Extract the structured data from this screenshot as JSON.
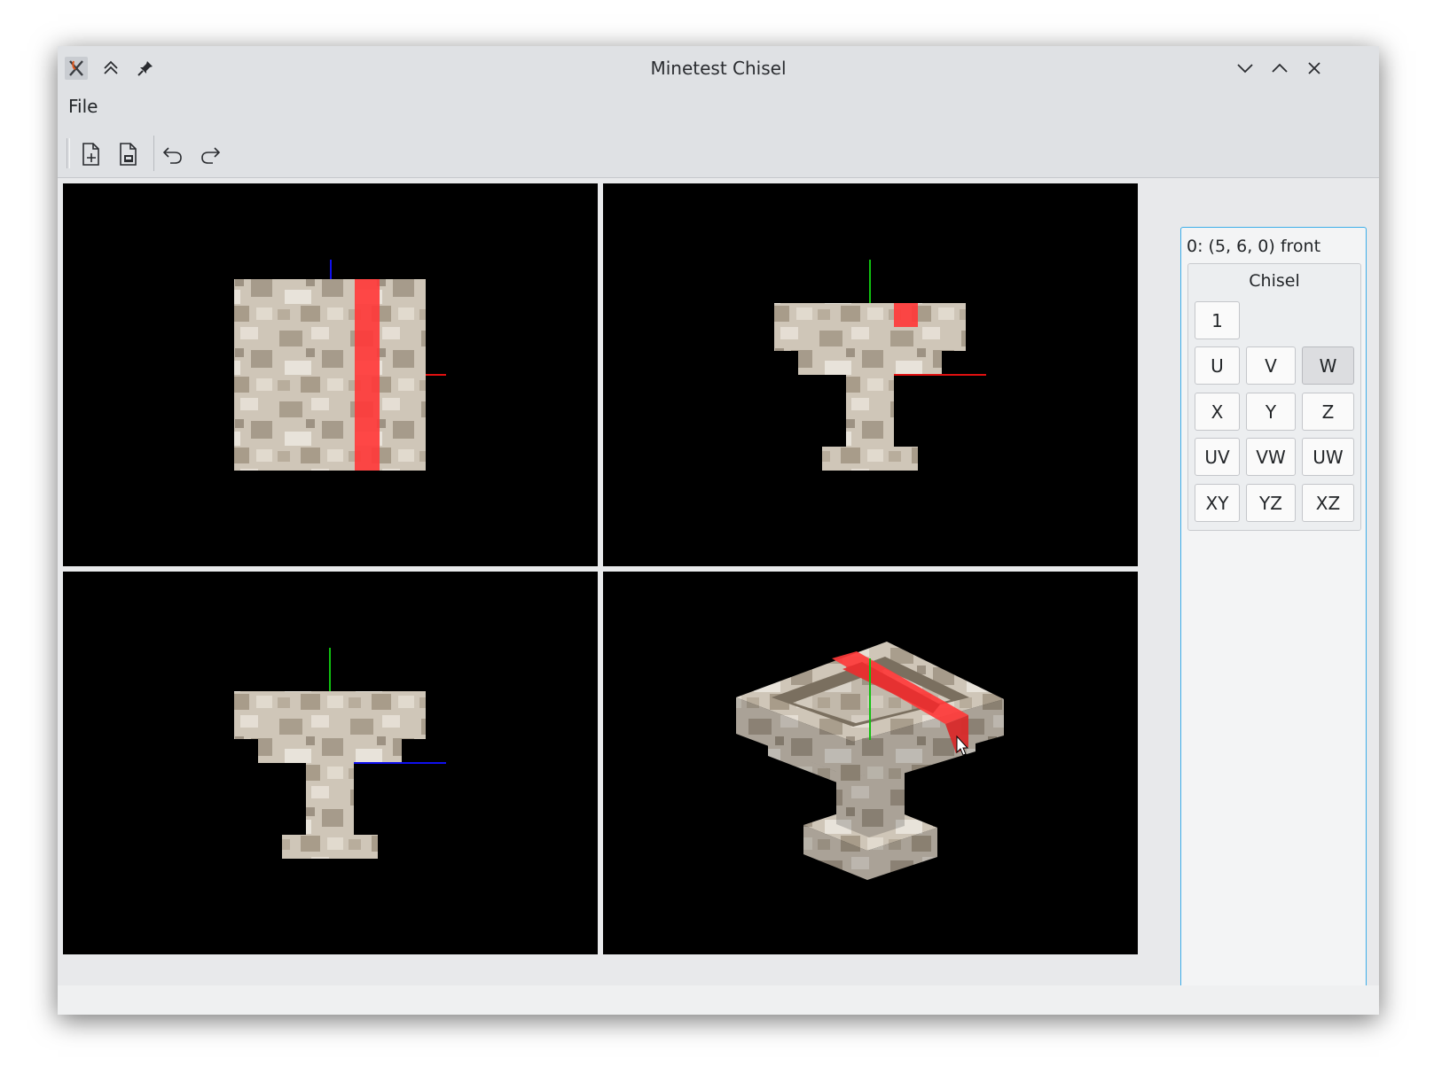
{
  "window": {
    "title": "Minetest Chisel"
  },
  "menubar": {
    "file_label": "File"
  },
  "side": {
    "coords": "0: (5, 6, 0) front",
    "chisel_title": "Chisel",
    "buttons": [
      "1",
      "U",
      "V",
      "W",
      "X",
      "Y",
      "Z",
      "UV",
      "VW",
      "UW",
      "XY",
      "YZ",
      "XZ"
    ],
    "active_button": "W"
  },
  "colors": {
    "selection": "#ff3a3a",
    "axis_x": "#e01010",
    "axis_y": "#10c010",
    "axis_z": "#1010ee",
    "stone_light": "#d9d2c6",
    "stone_dark": "#8e8372",
    "focus": "#3daee9"
  },
  "icons": [
    "app-x-icon",
    "keep-above-icon",
    "pin-icon",
    "minimize-icon",
    "maximize-icon",
    "close-icon",
    "new-file-icon",
    "open-file-icon",
    "undo-icon",
    "redo-icon",
    "mouse-cursor-icon"
  ]
}
